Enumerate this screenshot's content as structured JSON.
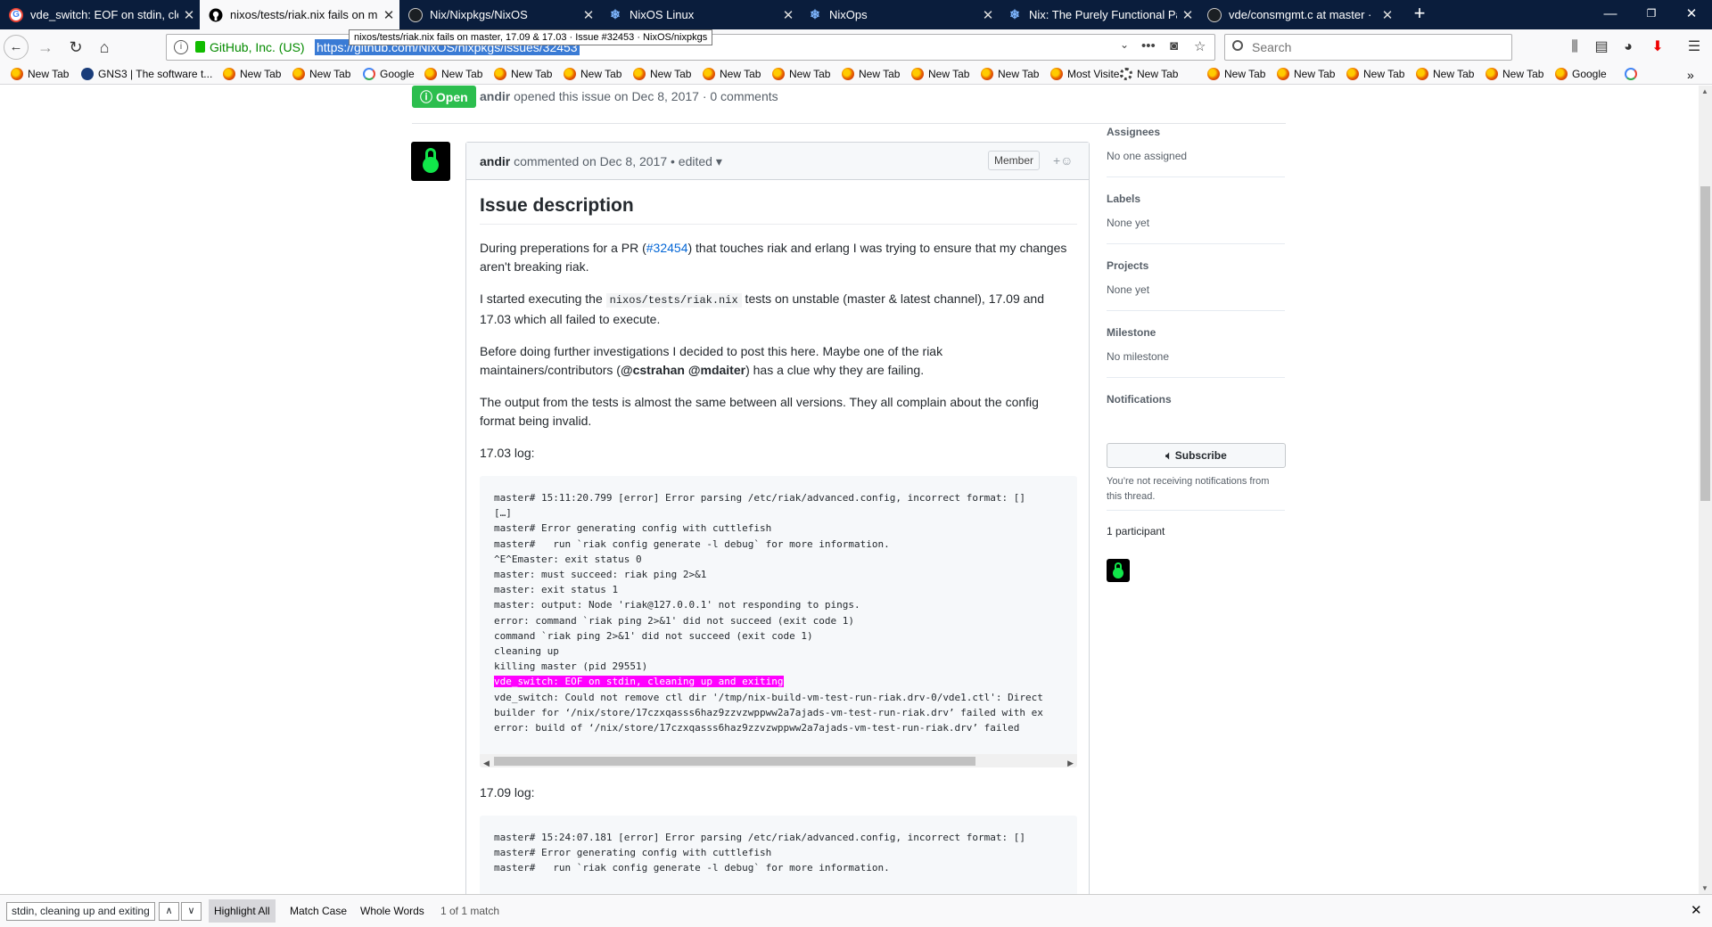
{
  "tabs": [
    {
      "title": "vde_switch: EOF on stdin, clear",
      "icon": "google-icon"
    },
    {
      "title": "nixos/tests/riak.nix fails on mas",
      "icon": "github-icon"
    },
    {
      "title": "Nix/Nixpkgs/NixOS",
      "icon": "github-icon"
    },
    {
      "title": "NixOS Linux",
      "icon": "nixos-icon"
    },
    {
      "title": "NixOps",
      "icon": "nixos-icon"
    },
    {
      "title": "Nix: The Purely Functional Pack",
      "icon": "nixos-icon"
    },
    {
      "title": "vde/consmgmt.c at master · ",
      "icon": "github-icon"
    }
  ],
  "tooltip": "nixos/tests/riak.nix fails on master, 17.09 & 17.03 · Issue #32453 · NixOS/nixpkgs",
  "urlbar": {
    "identity": "GitHub, Inc. (US)",
    "url": "https://github.com/NixOS/nixpkgs/issues/32453",
    "search_placeholder": "Search"
  },
  "bookmarks": [
    {
      "label": "New Tab",
      "icon": "firefox"
    },
    {
      "label": "GNS3 | The software t...",
      "icon": "gns"
    },
    {
      "label": "New Tab",
      "icon": "firefox"
    },
    {
      "label": "New Tab",
      "icon": "firefox"
    },
    {
      "label": "Google",
      "icon": "google"
    },
    {
      "label": "New Tab",
      "icon": "firefox"
    },
    {
      "label": "New Tab",
      "icon": "firefox"
    },
    {
      "label": "New Tab",
      "icon": "firefox"
    },
    {
      "label": "New Tab",
      "icon": "firefox"
    },
    {
      "label": "New Tab",
      "icon": "firefox"
    },
    {
      "label": "New Tab",
      "icon": "firefox"
    },
    {
      "label": "New Tab",
      "icon": "firefox"
    },
    {
      "label": "New Tab",
      "icon": "firefox"
    },
    {
      "label": "New Tab",
      "icon": "firefox"
    },
    {
      "label": "Most Visited",
      "icon": "gear"
    },
    {
      "label": "New Tab",
      "icon": "firefox"
    },
    {
      "label": "New Tab",
      "icon": "firefox"
    },
    {
      "label": "New Tab",
      "icon": "firefox"
    },
    {
      "label": "New Tab",
      "icon": "firefox"
    },
    {
      "label": "New Tab",
      "icon": "firefox"
    },
    {
      "label": "New Tab",
      "icon": "firefox"
    },
    {
      "label": "Google",
      "icon": "google"
    }
  ],
  "issue": {
    "state": "Open",
    "author": "andir",
    "opened_text": " opened this issue on Dec 8, 2017 · 0 comments"
  },
  "comment": {
    "author": "andir",
    "commented_text": " commented on Dec 8, 2017 • edited ▾",
    "role": "Member",
    "heading": "Issue description",
    "p1_before": "During preperations for a PR (",
    "p1_link": "#32454",
    "p1_after": ") that touches riak and erlang I was trying to ensure that my changes aren't breaking riak.",
    "p2_before": "I started executing the ",
    "p2_code": "nixos/tests/riak.nix",
    "p2_after": " tests on unstable (master & latest channel), 17.09 and 17.03 which all failed to execute.",
    "p3_before": "Before doing further investigations I decided to post this here. Maybe one of the riak maintainers/contributors (",
    "p3_mention1": "@cstrahan",
    "p3_space": " ",
    "p3_mention2": "@mdaiter",
    "p3_after": ") has a clue why they are failing.",
    "p4": "The output from the tests is almost the same between all versions. They all complain about the config format being invalid.",
    "log1_label": "17.03 log:",
    "log1_lines": [
      "master# 15:11:20.799 [error] Error parsing /etc/riak/advanced.config, incorrect format: []",
      "[…]",
      "master# Error generating config with cuttlefish",
      "master#   run `riak config generate -l debug` for more information.",
      "^E^Emaster: exit status 0",
      "master: must succeed: riak ping 2>&1",
      "master: exit status 1",
      "master: output: Node 'riak@127.0.0.1' not responding to pings.",
      "error: command `riak ping 2>&1' did not succeed (exit code 1)",
      "command `riak ping 2>&1' did not succeed (exit code 1)",
      "cleaning up",
      "killing master (pid 29551)"
    ],
    "log1_highlight": "vde_switch: EOF on stdin, cleaning up and exiting",
    "log1_tail": [
      "vde_switch: Could not remove ctl dir '/tmp/nix-build-vm-test-run-riak.drv-0/vde1.ctl': Direct",
      "builder for ‘/nix/store/17czxqasss6haz9zzvzwppww2a7ajads-vm-test-run-riak.drv’ failed with ex",
      "error: build of ‘/nix/store/17czxqasss6haz9zzvzwppww2a7ajads-vm-test-run-riak.drv’ failed"
    ],
    "log2_label": "17.09 log:",
    "log2_lines": [
      "master# 15:24:07.181 [error] Error parsing /etc/riak/advanced.config, incorrect format: []",
      "master# Error generating config with cuttlefish",
      "master#   run `riak config generate -l debug` for more information."
    ]
  },
  "sidebar": {
    "assignees_h": "Assignees",
    "assignees_v": "No one assigned",
    "labels_h": "Labels",
    "labels_v": "None yet",
    "projects_h": "Projects",
    "projects_v": "None yet",
    "milestone_h": "Milestone",
    "milestone_v": "No milestone",
    "notifications_h": "Notifications",
    "subscribe": "Subscribe",
    "subscribe_note": "You’re not receiving notifications from this thread.",
    "participants": "1 participant"
  },
  "findbar": {
    "query": "stdin, cleaning up and exiting",
    "highlight_all": "Highlight All",
    "match_case": "Match Case",
    "whole_words": "Whole Words",
    "status": "1 of 1 match"
  },
  "colors": {
    "tabbar": "#0a1d3c",
    "open_badge": "#2cbe4e",
    "highlight": "#ff00ff",
    "link": "#0366d6"
  }
}
